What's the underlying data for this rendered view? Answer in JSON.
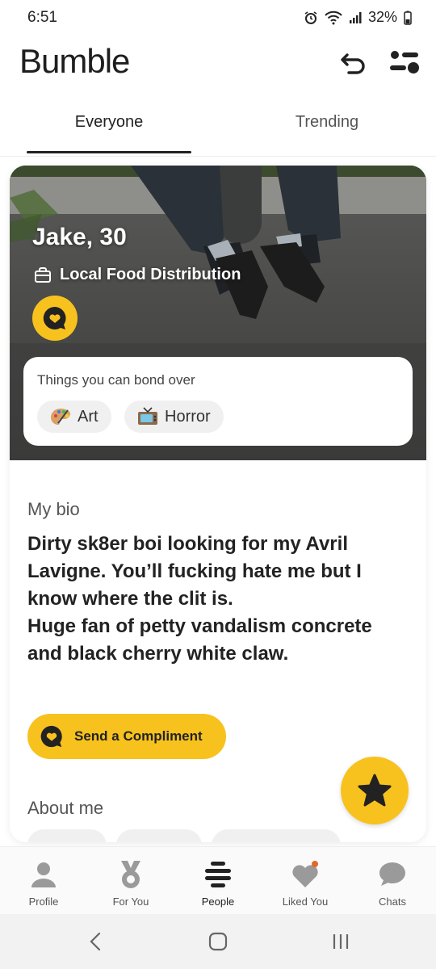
{
  "status_bar": {
    "time": "6:51",
    "battery": "32%"
  },
  "header": {
    "logo": "Bumble"
  },
  "tabs": [
    {
      "label": "Everyone",
      "active": true
    },
    {
      "label": "Trending",
      "active": false
    }
  ],
  "profile": {
    "name_age": "Jake, 30",
    "job": "Local Food Distribution",
    "bond_title": "Things you can bond over",
    "interests": [
      {
        "icon": "palette-icon",
        "label": "Art"
      },
      {
        "icon": "tv-icon",
        "label": "Horror"
      }
    ],
    "bio_label": "My bio",
    "bio": "Dirty sk8er boi looking for my Avril Lavigne. You’ll fucking hate me but I know where the clit is.\nHuge fan of petty vandalism concrete and black cherry white claw.",
    "send_compliment": "Send a Compliment",
    "about_label": "About me"
  },
  "bottom_nav": [
    {
      "label": "Profile",
      "icon": "person-icon"
    },
    {
      "label": "For You",
      "icon": "medal-icon"
    },
    {
      "label": "People",
      "icon": "hive-icon",
      "active": true
    },
    {
      "label": "Liked You",
      "icon": "heart-icon"
    },
    {
      "label": "Chats",
      "icon": "chat-bubble-icon"
    }
  ],
  "colors": {
    "accent": "#f7c21e",
    "text": "#222222",
    "muted": "#555555"
  }
}
